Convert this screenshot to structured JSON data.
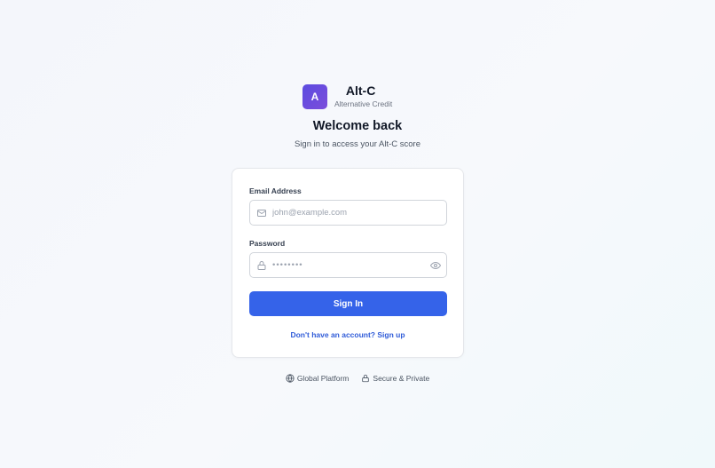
{
  "brand": {
    "logo_letter": "A",
    "name": "Alt-C",
    "tagline": "Alternative Credit",
    "accent": "#5b4ce0"
  },
  "heading": {
    "title": "Welcome back",
    "subtitle": "Sign in to access your Alt-C score"
  },
  "form": {
    "email_label": "Email Address",
    "email_placeholder": "john@example.com",
    "email_icon": "mail-icon",
    "password_label": "Password",
    "password_value": "••••••••",
    "password_icon": "lock-icon",
    "toggle_icon": "eye-icon",
    "submit_label": "Sign In",
    "submit_color": "#3563e9",
    "signup_link": "Don't have an account? Sign up"
  },
  "footer": {
    "items": [
      {
        "label": "Global Platform",
        "icon": "globe-icon"
      },
      {
        "label": "Secure & Private",
        "icon": "lock-icon"
      }
    ]
  }
}
